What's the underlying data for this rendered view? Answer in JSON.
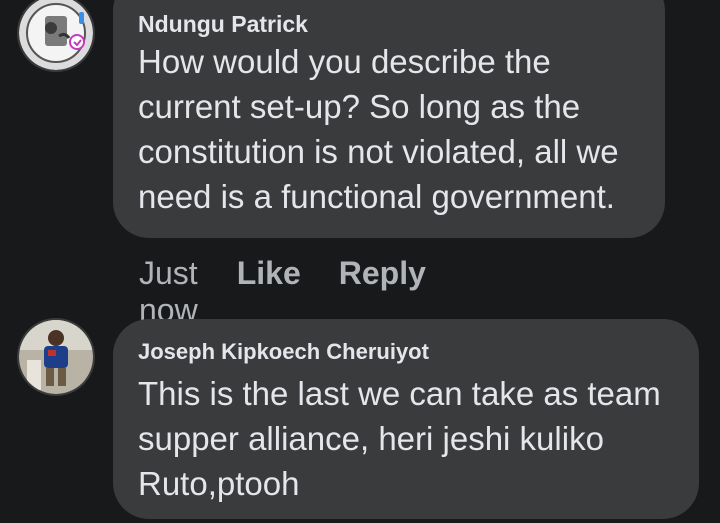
{
  "comments": [
    {
      "author": "Ndungu Patrick",
      "lines": [
        "How would you describe the",
        "current set-up? So long as the",
        "constitution is not violated, all we",
        "need is a functional government."
      ],
      "time": "Just now",
      "like_label": "Like",
      "reply_label": "Reply"
    },
    {
      "author": "Joseph Kipkoech Cheruiyot",
      "lines": [
        "This is the last we can take as team",
        "supper alliance, heri jeshi kuliko",
        "Ruto,ptooh"
      ]
    }
  ],
  "colors": {
    "background": "#18191a",
    "bubble": "#3a3b3c",
    "text": "#e4e6eb",
    "secondary": "#b0b3b8"
  }
}
